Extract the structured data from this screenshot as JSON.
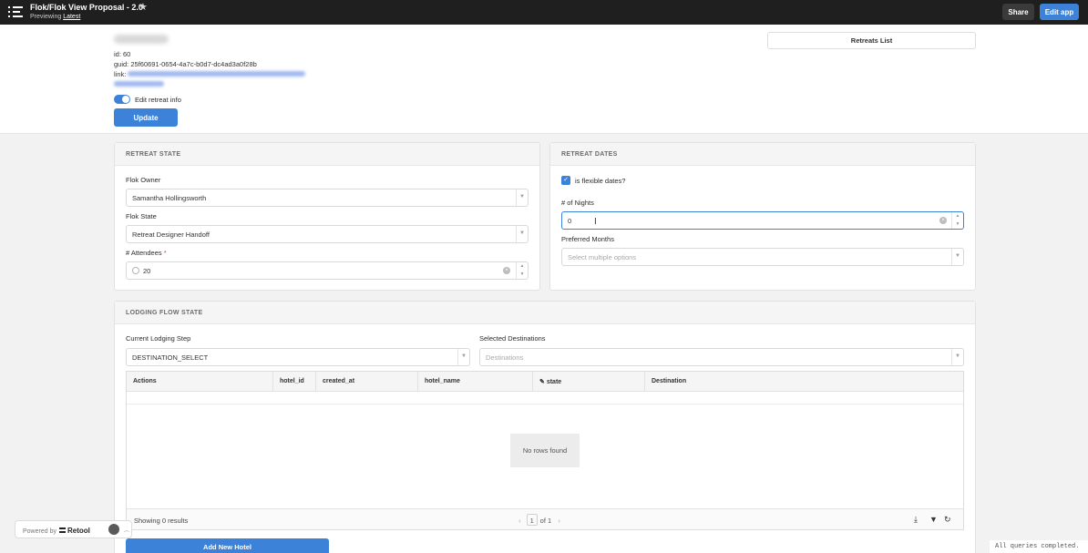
{
  "topbar": {
    "title": "Flok/Flok View Proposal - 2.0",
    "previewing_label": "Previewing",
    "version": "Latest",
    "share_label": "Share",
    "edit_app_label": "Edit app"
  },
  "header": {
    "id_line": "id: 60",
    "guid_line": "guid: 25f60691-0654-4a7c-b0d7-dc4ad3a0f28b",
    "link_label": "link:",
    "toggle_label": "Edit retreat info",
    "toggle_on": true,
    "update_label": "Update",
    "retreats_list_label": "Retreats List"
  },
  "retreat_state": {
    "title": "RETREAT STATE",
    "owner_label": "Flok Owner",
    "owner_value": "Samantha Hollingsworth",
    "state_label": "Flok State",
    "state_value": "Retreat Designer Handoff",
    "attendees_label": "# Attendees",
    "attendees_required": "*",
    "attendees_value": "20"
  },
  "retreat_dates": {
    "title": "RETREAT DATES",
    "flexible_label": "is flexible dates?",
    "flexible_checked": true,
    "nights_label": "# of Nights",
    "nights_value": "0",
    "months_label": "Preferred Months",
    "months_placeholder": "Select multiple options"
  },
  "lodging": {
    "title": "LODGING FLOW STATE",
    "step_label": "Current Lodging Step",
    "step_value": "DESTINATION_SELECT",
    "destinations_label": "Selected Destinations",
    "destinations_placeholder": "Destinations",
    "table": {
      "columns": [
        "Actions",
        "hotel_id",
        "created_at",
        "hotel_name",
        "state",
        "Destination"
      ],
      "empty_text": "No rows found",
      "showing": "Showing 0 results",
      "page": "1",
      "of_pages": "of 1"
    },
    "add_hotel_label": "Add New Hotel"
  },
  "footer": {
    "powered_by": "Powered by",
    "brand": "Retool",
    "queries_status": "All queries completed."
  },
  "colors": {
    "accent": "#3b82d8",
    "topbar": "#1f1f1f"
  }
}
